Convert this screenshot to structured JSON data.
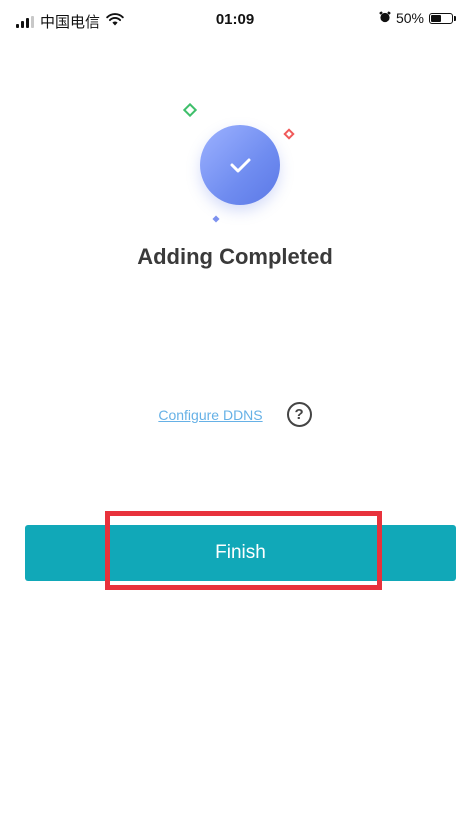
{
  "status_bar": {
    "carrier": "中国电信",
    "time": "01:09",
    "battery_percent": "50%",
    "battery_level": 0.5,
    "icons": [
      "signal-icon",
      "wifi-icon",
      "alarm-icon",
      "battery-icon"
    ]
  },
  "success": {
    "icon": "checkmark-icon",
    "gradient_colors": [
      "#9db2ff",
      "#5b78e6"
    ],
    "title": "Adding Completed"
  },
  "ddns": {
    "link_label": "Configure DDNS",
    "help_glyph": "?"
  },
  "actions": {
    "finish_label": "Finish",
    "finish_color": "#11a8b8",
    "highlight_color": "#e8323c"
  }
}
